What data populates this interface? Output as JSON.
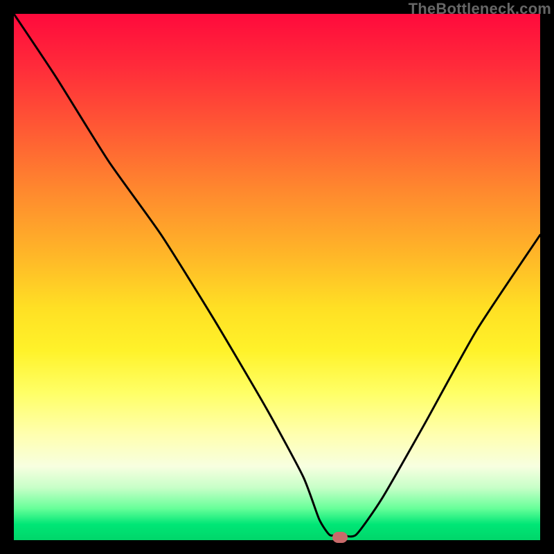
{
  "watermark": "TheBottleneck.com",
  "chart_data": {
    "type": "line",
    "title": "",
    "xlabel": "",
    "ylabel": "",
    "xlim": [
      0,
      100
    ],
    "ylim": [
      0,
      100
    ],
    "grid": false,
    "legend": false,
    "background_gradient": {
      "direction": "vertical",
      "stops": [
        {
          "pos": 0,
          "color": "#ff0a3c"
        },
        {
          "pos": 50,
          "color": "#ffe024"
        },
        {
          "pos": 80,
          "color": "#ffffb0"
        },
        {
          "pos": 100,
          "color": "#00d66a"
        }
      ]
    },
    "series": [
      {
        "name": "bottleneck-curve",
        "x": [
          0,
          8,
          18,
          28,
          38,
          48,
          55,
          58,
          60,
          62,
          65,
          70,
          78,
          88,
          100
        ],
        "y": [
          100,
          88,
          72,
          58,
          42,
          25,
          12,
          4,
          1,
          1,
          1,
          8,
          22,
          40,
          58
        ]
      }
    ],
    "marker": {
      "x": 62,
      "y": 0.5,
      "color": "#c96a6a"
    }
  }
}
